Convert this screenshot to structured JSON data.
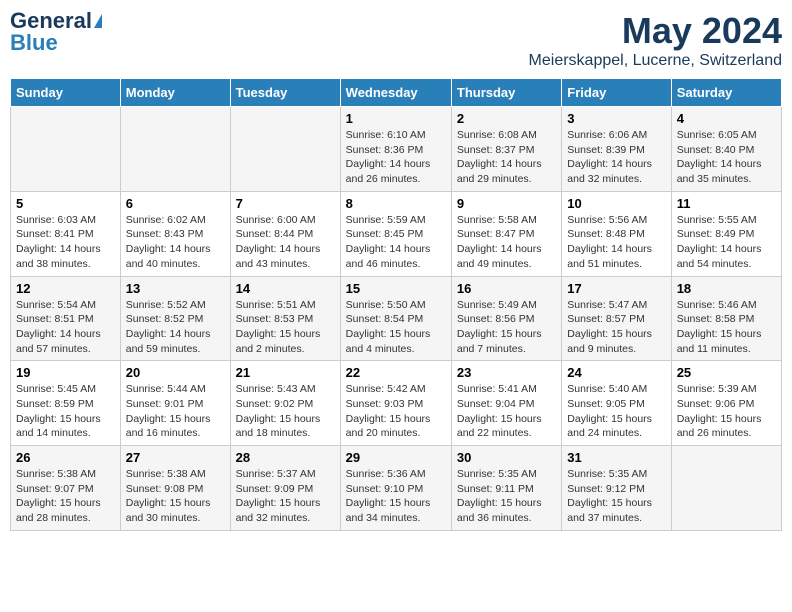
{
  "header": {
    "logo_line1": "General",
    "logo_line2": "Blue",
    "title": "May 2024",
    "subtitle": "Meierskappel, Lucerne, Switzerland"
  },
  "columns": [
    "Sunday",
    "Monday",
    "Tuesday",
    "Wednesday",
    "Thursday",
    "Friday",
    "Saturday"
  ],
  "weeks": [
    [
      {
        "day": "",
        "info": ""
      },
      {
        "day": "",
        "info": ""
      },
      {
        "day": "",
        "info": ""
      },
      {
        "day": "1",
        "info": "Sunrise: 6:10 AM\nSunset: 8:36 PM\nDaylight: 14 hours\nand 26 minutes."
      },
      {
        "day": "2",
        "info": "Sunrise: 6:08 AM\nSunset: 8:37 PM\nDaylight: 14 hours\nand 29 minutes."
      },
      {
        "day": "3",
        "info": "Sunrise: 6:06 AM\nSunset: 8:39 PM\nDaylight: 14 hours\nand 32 minutes."
      },
      {
        "day": "4",
        "info": "Sunrise: 6:05 AM\nSunset: 8:40 PM\nDaylight: 14 hours\nand 35 minutes."
      }
    ],
    [
      {
        "day": "5",
        "info": "Sunrise: 6:03 AM\nSunset: 8:41 PM\nDaylight: 14 hours\nand 38 minutes."
      },
      {
        "day": "6",
        "info": "Sunrise: 6:02 AM\nSunset: 8:43 PM\nDaylight: 14 hours\nand 40 minutes."
      },
      {
        "day": "7",
        "info": "Sunrise: 6:00 AM\nSunset: 8:44 PM\nDaylight: 14 hours\nand 43 minutes."
      },
      {
        "day": "8",
        "info": "Sunrise: 5:59 AM\nSunset: 8:45 PM\nDaylight: 14 hours\nand 46 minutes."
      },
      {
        "day": "9",
        "info": "Sunrise: 5:58 AM\nSunset: 8:47 PM\nDaylight: 14 hours\nand 49 minutes."
      },
      {
        "day": "10",
        "info": "Sunrise: 5:56 AM\nSunset: 8:48 PM\nDaylight: 14 hours\nand 51 minutes."
      },
      {
        "day": "11",
        "info": "Sunrise: 5:55 AM\nSunset: 8:49 PM\nDaylight: 14 hours\nand 54 minutes."
      }
    ],
    [
      {
        "day": "12",
        "info": "Sunrise: 5:54 AM\nSunset: 8:51 PM\nDaylight: 14 hours\nand 57 minutes."
      },
      {
        "day": "13",
        "info": "Sunrise: 5:52 AM\nSunset: 8:52 PM\nDaylight: 14 hours\nand 59 minutes."
      },
      {
        "day": "14",
        "info": "Sunrise: 5:51 AM\nSunset: 8:53 PM\nDaylight: 15 hours\nand 2 minutes."
      },
      {
        "day": "15",
        "info": "Sunrise: 5:50 AM\nSunset: 8:54 PM\nDaylight: 15 hours\nand 4 minutes."
      },
      {
        "day": "16",
        "info": "Sunrise: 5:49 AM\nSunset: 8:56 PM\nDaylight: 15 hours\nand 7 minutes."
      },
      {
        "day": "17",
        "info": "Sunrise: 5:47 AM\nSunset: 8:57 PM\nDaylight: 15 hours\nand 9 minutes."
      },
      {
        "day": "18",
        "info": "Sunrise: 5:46 AM\nSunset: 8:58 PM\nDaylight: 15 hours\nand 11 minutes."
      }
    ],
    [
      {
        "day": "19",
        "info": "Sunrise: 5:45 AM\nSunset: 8:59 PM\nDaylight: 15 hours\nand 14 minutes."
      },
      {
        "day": "20",
        "info": "Sunrise: 5:44 AM\nSunset: 9:01 PM\nDaylight: 15 hours\nand 16 minutes."
      },
      {
        "day": "21",
        "info": "Sunrise: 5:43 AM\nSunset: 9:02 PM\nDaylight: 15 hours\nand 18 minutes."
      },
      {
        "day": "22",
        "info": "Sunrise: 5:42 AM\nSunset: 9:03 PM\nDaylight: 15 hours\nand 20 minutes."
      },
      {
        "day": "23",
        "info": "Sunrise: 5:41 AM\nSunset: 9:04 PM\nDaylight: 15 hours\nand 22 minutes."
      },
      {
        "day": "24",
        "info": "Sunrise: 5:40 AM\nSunset: 9:05 PM\nDaylight: 15 hours\nand 24 minutes."
      },
      {
        "day": "25",
        "info": "Sunrise: 5:39 AM\nSunset: 9:06 PM\nDaylight: 15 hours\nand 26 minutes."
      }
    ],
    [
      {
        "day": "26",
        "info": "Sunrise: 5:38 AM\nSunset: 9:07 PM\nDaylight: 15 hours\nand 28 minutes."
      },
      {
        "day": "27",
        "info": "Sunrise: 5:38 AM\nSunset: 9:08 PM\nDaylight: 15 hours\nand 30 minutes."
      },
      {
        "day": "28",
        "info": "Sunrise: 5:37 AM\nSunset: 9:09 PM\nDaylight: 15 hours\nand 32 minutes."
      },
      {
        "day": "29",
        "info": "Sunrise: 5:36 AM\nSunset: 9:10 PM\nDaylight: 15 hours\nand 34 minutes."
      },
      {
        "day": "30",
        "info": "Sunrise: 5:35 AM\nSunset: 9:11 PM\nDaylight: 15 hours\nand 36 minutes."
      },
      {
        "day": "31",
        "info": "Sunrise: 5:35 AM\nSunset: 9:12 PM\nDaylight: 15 hours\nand 37 minutes."
      },
      {
        "day": "",
        "info": ""
      }
    ]
  ]
}
